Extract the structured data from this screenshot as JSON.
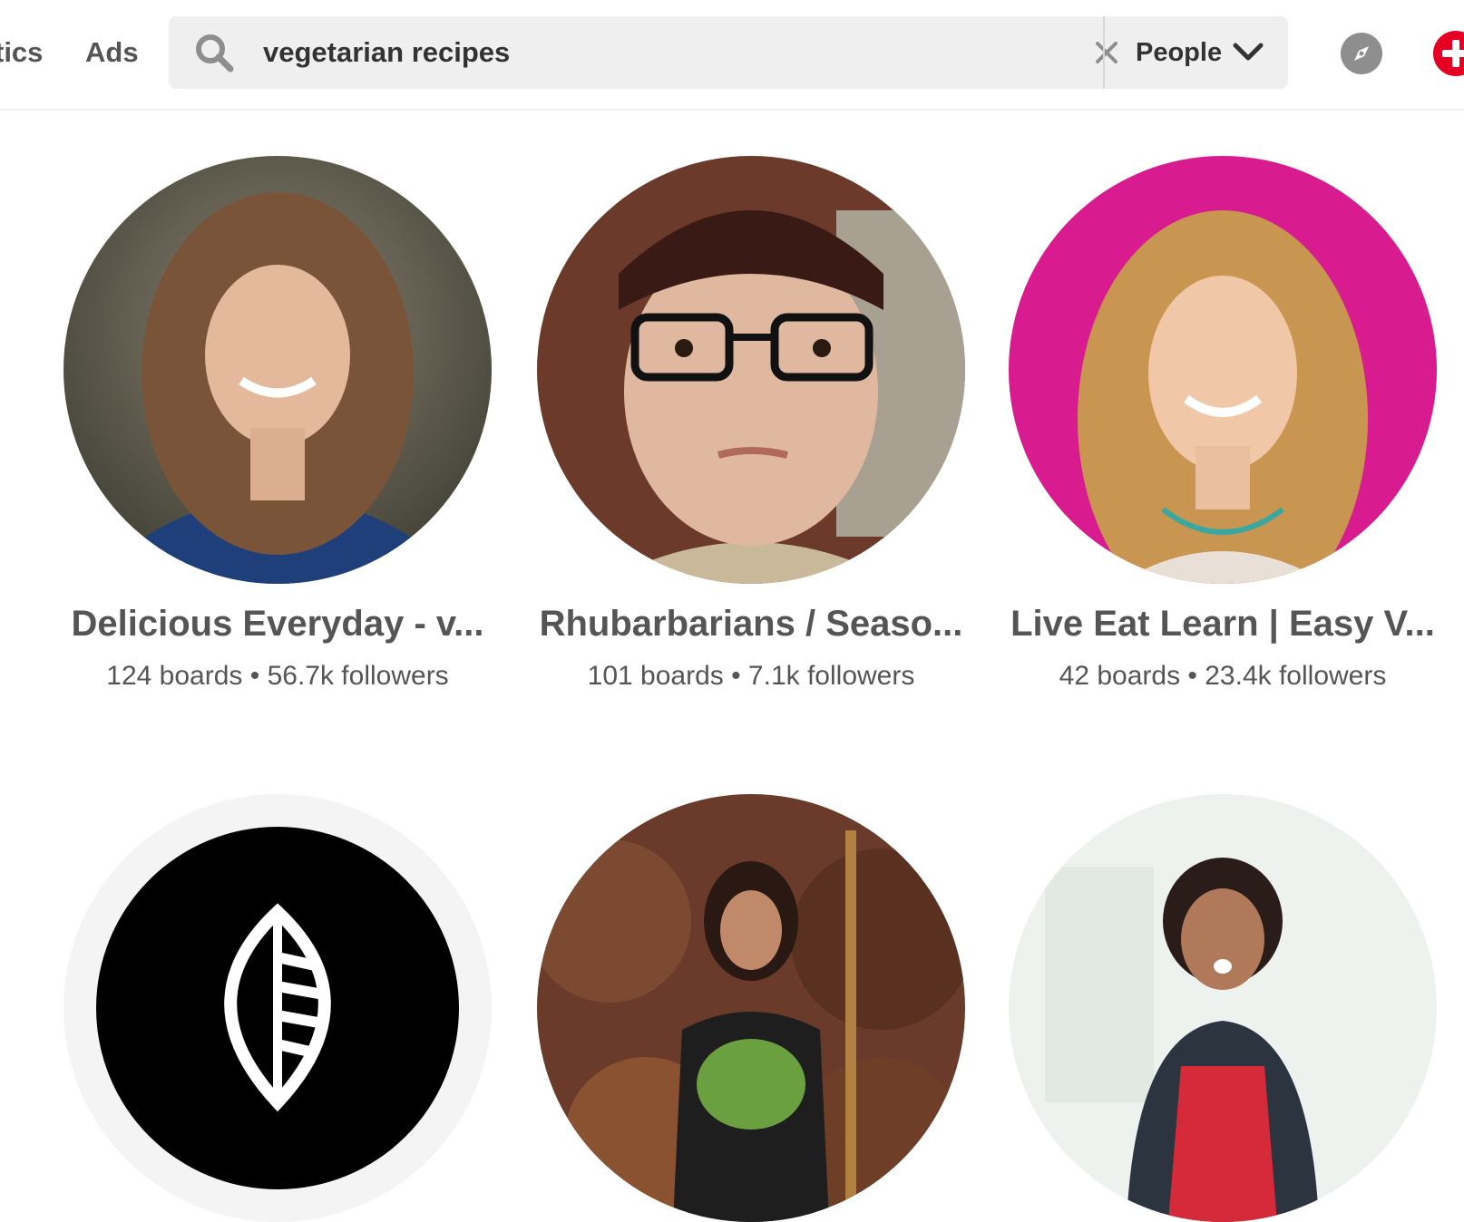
{
  "header": {
    "nav_items": [
      {
        "label": "tics"
      },
      {
        "label": "Ads"
      }
    ],
    "search": {
      "value": "vegetarian recipes",
      "placeholder": "Search"
    },
    "filter": {
      "selected": "People"
    },
    "icons": {
      "search": "search-icon",
      "clear": "close-icon",
      "filter_chevron": "chevron-down-icon",
      "explore": "compass-icon",
      "create": "plus-icon"
    },
    "colors": {
      "brand_red": "#e60023",
      "search_bg": "#efefef"
    }
  },
  "results": [
    {
      "name": "Delicious Everyday - v...",
      "boards": "124 boards",
      "followers": "56.7k followers",
      "stats": "124 boards • 56.7k followers"
    },
    {
      "name": "Rhubarbarians / Seaso...",
      "boards": "101 boards",
      "followers": "7.1k followers",
      "stats": "101 boards • 7.1k followers"
    },
    {
      "name": "Live Eat Learn | Easy V...",
      "boards": "42 boards",
      "followers": "23.4k followers",
      "stats": "42 boards • 23.4k followers"
    },
    {
      "name": "",
      "stats": ""
    },
    {
      "name": "",
      "stats": ""
    },
    {
      "name": "",
      "stats": ""
    }
  ]
}
